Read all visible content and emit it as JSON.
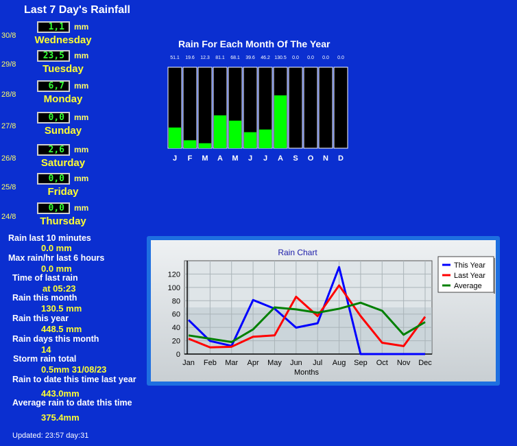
{
  "title": "Last 7 Day's Rainfall",
  "unit": "mm",
  "days": [
    {
      "date": "30/8",
      "value": "1,1",
      "name": "Wednesday"
    },
    {
      "date": "29/8",
      "value": "23,5",
      "name": "Tuesday"
    },
    {
      "date": "28/8",
      "value": "6,7",
      "name": "Monday"
    },
    {
      "date": "27/8",
      "value": "0,0",
      "name": "Sunday"
    },
    {
      "date": "26/8",
      "value": "2,6",
      "name": "Saturday"
    },
    {
      "date": "25/8",
      "value": "0,0",
      "name": "Friday"
    },
    {
      "date": "24/8",
      "value": "0,0",
      "name": "Thursday"
    }
  ],
  "stats": [
    {
      "label": "Rain last 10 minutes",
      "value": "0.0 mm"
    },
    {
      "label": "Max rain/hr last 6 hours",
      "value": "0.0 mm"
    },
    {
      "label": "Time of last rain",
      "value": "at 05:23"
    },
    {
      "label": "Rain this month",
      "value": "130.5 mm"
    },
    {
      "label": "Rain this year",
      "value": "448.5 mm"
    },
    {
      "label": "Rain days this month",
      "value": "14"
    },
    {
      "label": "Storm rain total",
      "value": "0.5mm 31/08/23"
    },
    {
      "label": "Rain to date this time last year",
      "value": "443.0mm"
    },
    {
      "label": "Average rain to date this time",
      "value": "375.4mm"
    }
  ],
  "updated": "Updated: 23:57 day:31",
  "chart_data": [
    {
      "type": "bar",
      "title": "Rain For Each Month Of The Year",
      "categories": [
        "J",
        "F",
        "M",
        "A",
        "M",
        "J",
        "J",
        "A",
        "S",
        "O",
        "N",
        "D"
      ],
      "values": [
        51.1,
        19.6,
        12.3,
        81.1,
        68.1,
        39.6,
        46.2,
        130.5,
        0.0,
        0.0,
        0.0,
        0.0
      ],
      "value_labels": [
        "51.1",
        "19.6",
        "12.3",
        "81.1",
        "68.1",
        "39.6",
        "46.2",
        "130.5",
        "0.0",
        "0.0",
        "0.0",
        "0.0"
      ],
      "ylim": [
        0,
        200
      ],
      "colors": {
        "bar": "#00ff00",
        "background": "#000000"
      }
    },
    {
      "type": "line",
      "title": "Rain Chart",
      "xlabel": "Months",
      "ylabel": "",
      "categories": [
        "Jan",
        "Feb",
        "Mar",
        "Apr",
        "May",
        "Jun",
        "Jul",
        "Aug",
        "Sep",
        "Oct",
        "Nov",
        "Dec"
      ],
      "yticks": [
        0,
        20,
        40,
        60,
        80,
        100,
        120
      ],
      "ylim": [
        0,
        140
      ],
      "grid": true,
      "legend": "top-right",
      "series": [
        {
          "name": "This Year",
          "color": "#0000ff",
          "values": [
            51.1,
            19.6,
            12.3,
            81.1,
            68.1,
            39.6,
            46.2,
            130.5,
            0,
            0,
            0,
            0
          ]
        },
        {
          "name": "Last Year",
          "color": "#ff0000",
          "values": [
            23,
            10,
            11,
            26,
            28,
            86,
            57,
            103,
            57,
            17,
            12,
            56
          ]
        },
        {
          "name": "Average",
          "color": "#008000",
          "values": [
            28,
            23,
            18,
            37,
            70,
            67,
            62,
            68,
            77,
            65,
            29,
            48
          ]
        }
      ]
    }
  ]
}
